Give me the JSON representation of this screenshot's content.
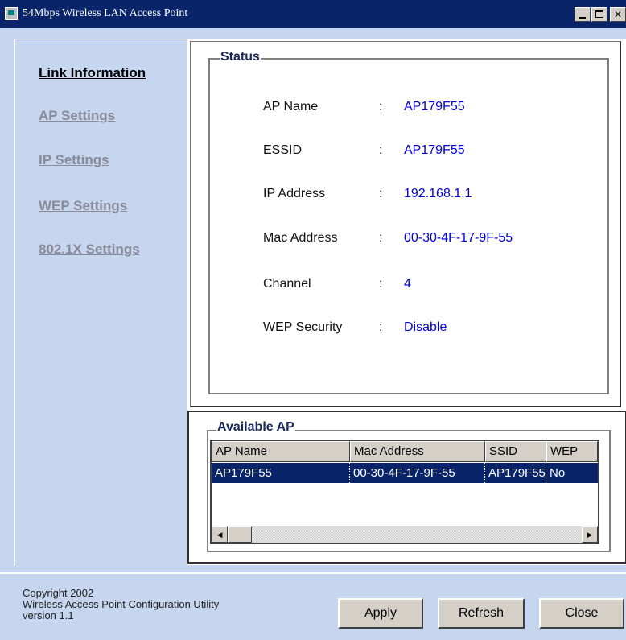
{
  "window": {
    "title": "54Mbps Wireless LAN Access Point",
    "min_icon": "minimize-icon",
    "max_icon": "maximize-icon",
    "close_label": "✕"
  },
  "nav": {
    "items": [
      {
        "label": "Link Information",
        "active": true
      },
      {
        "label": "AP Settings",
        "active": false
      },
      {
        "label": "IP Settings",
        "active": false
      },
      {
        "label": "WEP Settings",
        "active": false
      },
      {
        "label": "802.1X Settings",
        "active": false
      }
    ]
  },
  "status": {
    "title": "Status",
    "rows": [
      {
        "label": "AP Name",
        "colon": ":",
        "value": "AP179F55"
      },
      {
        "label": "ESSID",
        "colon": ":",
        "value": "AP179F55"
      },
      {
        "label": "IP Address",
        "colon": ":",
        "value": "192.168.1.1"
      },
      {
        "label": "Mac Address",
        "colon": ":",
        "value": "00-30-4F-17-9F-55"
      },
      {
        "label": "Channel",
        "colon": ":",
        "value": "4"
      },
      {
        "label": "WEP Security",
        "colon": ":",
        "value": "Disable"
      }
    ]
  },
  "available_ap": {
    "title": "Available AP",
    "columns": [
      "AP Name",
      "Mac Address",
      "SSID",
      "WEP"
    ],
    "rows": [
      [
        "AP179F55",
        "00-30-4F-17-9F-55",
        "AP179F55",
        "No"
      ]
    ],
    "scroll_left_icon": "◀",
    "scroll_right_icon": "▶"
  },
  "footer": {
    "copyright_lines": [
      "Copyright 2002",
      "Wireless Access Point Configuration Utility",
      "version 1.1"
    ],
    "apply_label": "Apply",
    "refresh_label": "Refresh",
    "close_label": "Close"
  },
  "colors": {
    "titlebar": "#0a246a",
    "background": "#c5d6ee",
    "value_text": "#0000dd",
    "selection": "#0a246a"
  }
}
